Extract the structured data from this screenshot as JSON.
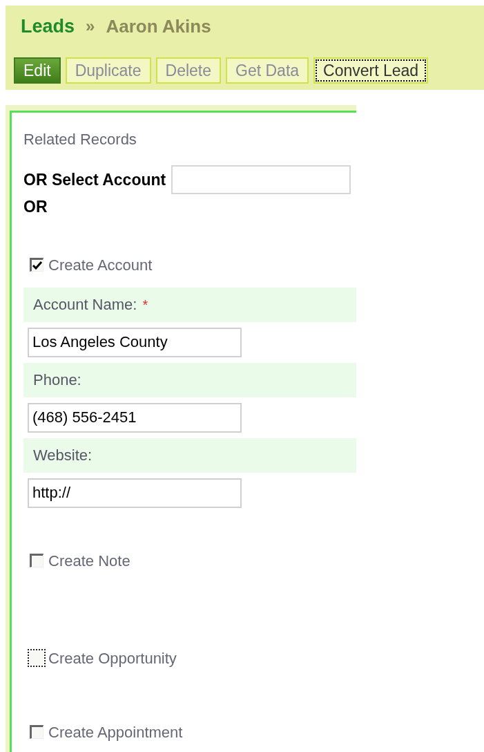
{
  "breadcrumb": {
    "parent": "Leads",
    "separator": "»",
    "current": "Aaron Akins"
  },
  "toolbar": [
    {
      "label": "Edit",
      "selected": true,
      "focused": false
    },
    {
      "label": "Duplicate",
      "selected": false,
      "focused": false
    },
    {
      "label": "Delete",
      "selected": false,
      "focused": false
    },
    {
      "label": "Get Data",
      "selected": false,
      "focused": false
    },
    {
      "label": "Convert Lead",
      "selected": false,
      "focused": true
    }
  ],
  "panel": {
    "title": "Related Records",
    "select_account": {
      "label": "OR Select Account"
    },
    "or_text": "OR",
    "sections": [
      {
        "label": "Create Account",
        "checked": true,
        "focused": false,
        "fields": [
          {
            "label": "Account Name:",
            "required_mark": "*",
            "value": "Los Angeles County"
          },
          {
            "label": "Phone:",
            "value": "(468) 556-2451"
          },
          {
            "label": "Website:",
            "value": "http://"
          }
        ]
      },
      {
        "label": "Create Note",
        "checked": false,
        "focused": false
      },
      {
        "label": "Create Opportunity",
        "checked": false,
        "focused": true
      },
      {
        "label": "Create Appointment",
        "checked": false,
        "focused": false
      }
    ]
  }
}
